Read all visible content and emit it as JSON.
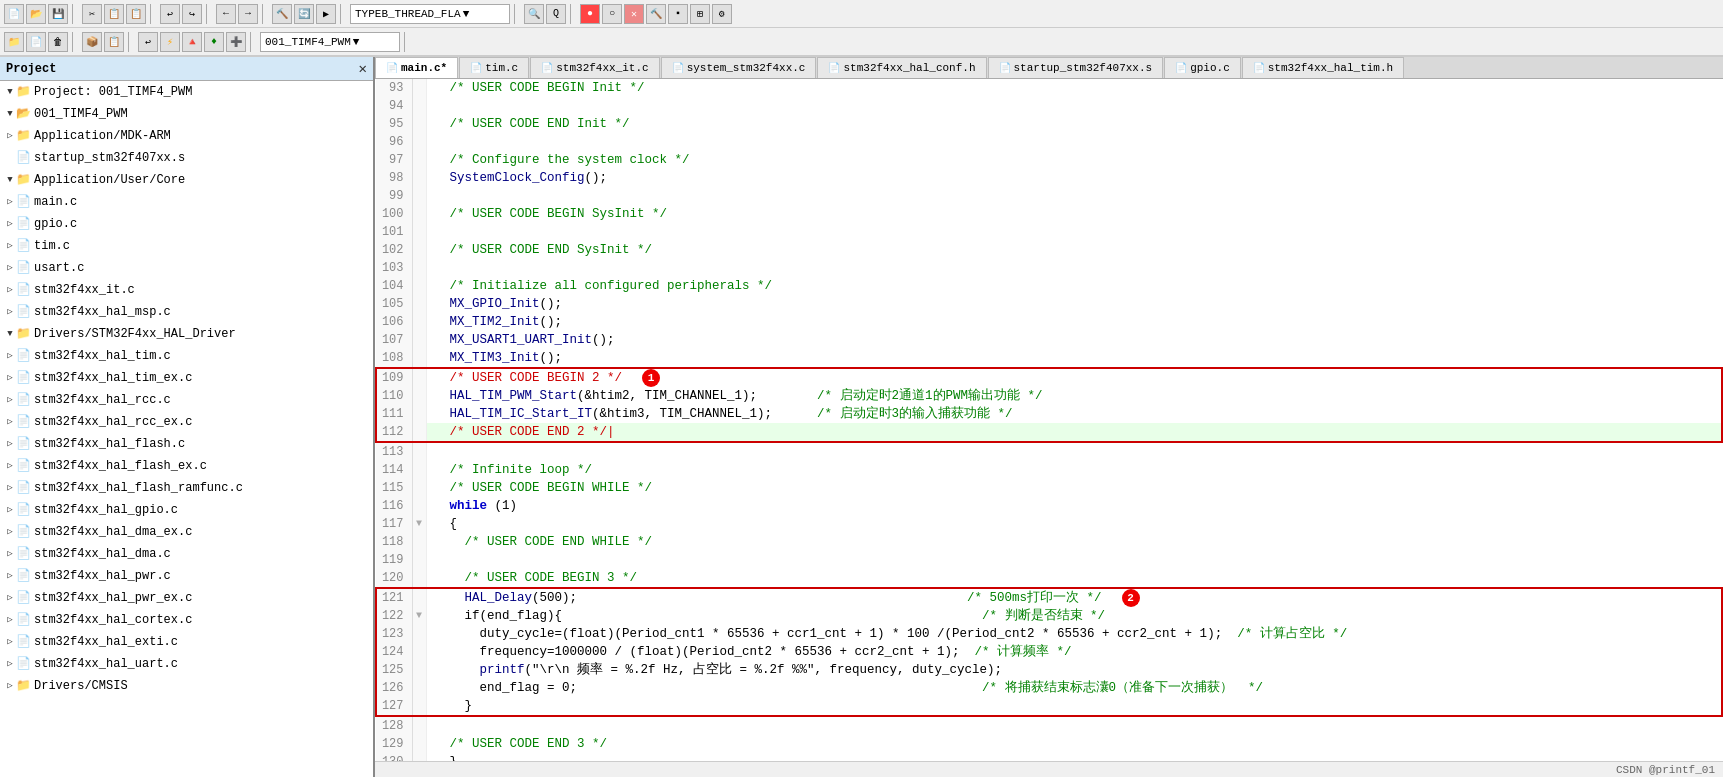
{
  "toolbar": {
    "row1_buttons": [
      "💾",
      "📄",
      "🖨",
      "✂",
      "📋",
      "📄",
      "↩",
      "↪",
      "←",
      "→",
      "⏸",
      "⏭",
      "⏮",
      "⏭",
      "⏹",
      "⏸",
      "▶",
      "⏺",
      "🔲",
      "📊",
      "🔧",
      "🔍",
      "Q",
      "🔴",
      "⭕",
      "🚫",
      "🔨",
      "▪",
      "🔲",
      "⚙"
    ],
    "row2_buttons": [
      "📁",
      "📄",
      "🗑",
      "📦",
      "📋",
      "↩",
      "⚡",
      "🔺",
      "🔸",
      "➕"
    ],
    "project_dropdown": "001_TIMF4_PWM",
    "target_dropdown": "TYPEB_THREAD_FLA"
  },
  "sidebar": {
    "title": "Project",
    "items": [
      {
        "id": "project-root",
        "label": "Project: 001_TIMF4_PWM",
        "level": 0,
        "expanded": true,
        "type": "project"
      },
      {
        "id": "001_TIMF4_PWM",
        "label": "001_TIMF4_PWM",
        "level": 1,
        "expanded": true,
        "type": "folder"
      },
      {
        "id": "app-mdk",
        "label": "Application/MDK-ARM",
        "level": 2,
        "expanded": false,
        "type": "folder"
      },
      {
        "id": "startup",
        "label": "startup_stm32f407xx.s",
        "level": 3,
        "type": "file"
      },
      {
        "id": "app-user-core",
        "label": "Application/User/Core",
        "level": 2,
        "expanded": true,
        "type": "folder"
      },
      {
        "id": "main-c",
        "label": "main.c",
        "level": 3,
        "type": "file"
      },
      {
        "id": "gpio-c",
        "label": "gpio.c",
        "level": 3,
        "type": "file"
      },
      {
        "id": "tim-c",
        "label": "tim.c",
        "level": 3,
        "type": "file"
      },
      {
        "id": "usart-c",
        "label": "usart.c",
        "level": 3,
        "type": "file"
      },
      {
        "id": "stm32f4xx-it",
        "label": "stm32f4xx_it.c",
        "level": 3,
        "type": "file"
      },
      {
        "id": "stm32f4xx-hal-msp",
        "label": "stm32f4xx_hal_msp.c",
        "level": 3,
        "type": "file"
      },
      {
        "id": "drivers-stm32",
        "label": "Drivers/STM32F4xx_HAL_Driver",
        "level": 2,
        "expanded": true,
        "type": "folder"
      },
      {
        "id": "hal-tim",
        "label": "stm32f4xx_hal_tim.c",
        "level": 3,
        "type": "file"
      },
      {
        "id": "hal-tim-ex",
        "label": "stm32f4xx_hal_tim_ex.c",
        "level": 3,
        "type": "file"
      },
      {
        "id": "hal-rcc",
        "label": "stm32f4xx_hal_rcc.c",
        "level": 3,
        "type": "file"
      },
      {
        "id": "hal-rcc-ex",
        "label": "stm32f4xx_hal_rcc_ex.c",
        "level": 3,
        "type": "file"
      },
      {
        "id": "hal-flash",
        "label": "stm32f4xx_hal_flash.c",
        "level": 3,
        "type": "file"
      },
      {
        "id": "hal-flash-ex",
        "label": "stm32f4xx_hal_flash_ex.c",
        "level": 3,
        "type": "file"
      },
      {
        "id": "hal-flash-ram",
        "label": "stm32f4xx_hal_flash_ramfunc.c",
        "level": 3,
        "type": "file"
      },
      {
        "id": "hal-gpio",
        "label": "stm32f4xx_hal_gpio.c",
        "level": 3,
        "type": "file"
      },
      {
        "id": "hal-dma-ex",
        "label": "stm32f4xx_hal_dma_ex.c",
        "level": 3,
        "type": "file"
      },
      {
        "id": "hal-dma",
        "label": "stm32f4xx_hal_dma.c",
        "level": 3,
        "type": "file"
      },
      {
        "id": "hal-pwr",
        "label": "stm32f4xx_hal_pwr.c",
        "level": 3,
        "type": "file"
      },
      {
        "id": "hal-pwr-ex",
        "label": "stm32f4xx_hal_pwr_ex.c",
        "level": 3,
        "type": "file"
      },
      {
        "id": "hal-cortex",
        "label": "stm32f4xx_hal_cortex.c",
        "level": 3,
        "type": "file"
      },
      {
        "id": "hal-exti",
        "label": "stm32f4xx_hal_exti.c",
        "level": 3,
        "type": "file"
      },
      {
        "id": "hal-uart",
        "label": "stm32f4xx_hal_uart.c",
        "level": 3,
        "type": "file"
      },
      {
        "id": "drivers-cmsis",
        "label": "Drivers/CMSIS",
        "level": 2,
        "expanded": false,
        "type": "folder"
      }
    ]
  },
  "tabs": [
    {
      "id": "main-c",
      "label": "main.c",
      "active": true,
      "modified": true
    },
    {
      "id": "tim-c",
      "label": "tim.c",
      "active": false
    },
    {
      "id": "stm32f4xx-it",
      "label": "stm32f4xx_it.c",
      "active": false
    },
    {
      "id": "system-stm32",
      "label": "system_stm32f4xx.c",
      "active": false
    },
    {
      "id": "stm32-hal-conf",
      "label": "stm32f4xx_hal_conf.h",
      "active": false
    },
    {
      "id": "startup-file",
      "label": "startup_stm32f407xx.s",
      "active": false
    },
    {
      "id": "gpio-c",
      "label": "gpio.c",
      "active": false
    },
    {
      "id": "stm32-hal-tim-h",
      "label": "stm32f4xx_hal_tim.h",
      "active": false
    }
  ],
  "code": {
    "lines": [
      {
        "num": 93,
        "fold": "",
        "text": "  /* USER CODE BEGIN Init */",
        "style": "comment"
      },
      {
        "num": 94,
        "fold": "",
        "text": "",
        "style": ""
      },
      {
        "num": 95,
        "fold": "",
        "text": "  /* USER CODE END Init */",
        "style": "comment"
      },
      {
        "num": 96,
        "fold": "",
        "text": "",
        "style": ""
      },
      {
        "num": 97,
        "fold": "",
        "text": "  /* Configure the system clock */",
        "style": "comment"
      },
      {
        "num": 98,
        "fold": "",
        "text": "  SystemClock_Config();",
        "style": ""
      },
      {
        "num": 99,
        "fold": "",
        "text": "",
        "style": ""
      },
      {
        "num": 100,
        "fold": "",
        "text": "  /* USER CODE BEGIN SysInit */",
        "style": "comment"
      },
      {
        "num": 101,
        "fold": "",
        "text": "",
        "style": ""
      },
      {
        "num": 102,
        "fold": "",
        "text": "  /* USER CODE END SysInit */",
        "style": "comment"
      },
      {
        "num": 103,
        "fold": "",
        "text": "",
        "style": ""
      },
      {
        "num": 104,
        "fold": "",
        "text": "  /* Initialize all configured peripherals */",
        "style": "comment"
      },
      {
        "num": 105,
        "fold": "",
        "text": "  MX_GPIO_Init();",
        "style": ""
      },
      {
        "num": 106,
        "fold": "",
        "text": "  MX_TIM2_Init();",
        "style": ""
      },
      {
        "num": 107,
        "fold": "",
        "text": "  MX_USART1_UART_Init();",
        "style": ""
      },
      {
        "num": 108,
        "fold": "",
        "text": "  MX_TIM3_Init();",
        "style": ""
      },
      {
        "num": 109,
        "fold": "redbox1-start",
        "text": "  /* USER CODE BEGIN 2 */",
        "style": "comment-red"
      },
      {
        "num": 110,
        "fold": "",
        "text": "  HAL_TIM_PWM_Start(&htim2, TIM_CHANNEL_1);        /* 启动定时2通道1的PWM输出功能 */",
        "style": ""
      },
      {
        "num": 111,
        "fold": "",
        "text": "  HAL_TIM_IC_Start_IT(&htim3, TIM_CHANNEL_1);      /* 启动定时3的输入捕获功能 */",
        "style": ""
      },
      {
        "num": 112,
        "fold": "redbox1-end",
        "text": "  /* USER CODE END 2 */|",
        "style": "comment-red",
        "highlight": true
      },
      {
        "num": 113,
        "fold": "",
        "text": "",
        "style": ""
      },
      {
        "num": 114,
        "fold": "",
        "text": "  /* Infinite loop */",
        "style": "comment"
      },
      {
        "num": 115,
        "fold": "",
        "text": "  /* USER CODE BEGIN WHILE */",
        "style": "comment"
      },
      {
        "num": 116,
        "fold": "",
        "text": "  while (1)",
        "style": "keyword"
      },
      {
        "num": 117,
        "fold": "▼",
        "text": "  {",
        "style": ""
      },
      {
        "num": 118,
        "fold": "",
        "text": "    /* USER CODE END WHILE */",
        "style": "comment"
      },
      {
        "num": 119,
        "fold": "",
        "text": "",
        "style": ""
      },
      {
        "num": 120,
        "fold": "",
        "text": "    /* USER CODE BEGIN 3 */",
        "style": "comment"
      },
      {
        "num": 121,
        "fold": "redbox2-start",
        "text": "    HAL_Delay(500);                                                    /* 500ms打印一次 */",
        "style": ""
      },
      {
        "num": 122,
        "fold": "▼",
        "text": "    if(end_flag){                                                        /* 判断是否结束 */",
        "style": ""
      },
      {
        "num": 123,
        "fold": "",
        "text": "      duty_cycle=(float)(Period_cnt1 * 65536 + ccr1_cnt + 1) * 100 /(Period_cnt2 * 65536 + ccr2_cnt + 1);  /* 计算占空比 */",
        "style": ""
      },
      {
        "num": 124,
        "fold": "",
        "text": "      frequency=1000000 / (float)(Period_cnt2 * 65536 + ccr2_cnt + 1);  /* 计算频率 */",
        "style": ""
      },
      {
        "num": 125,
        "fold": "",
        "text": "      printf(\"\\r\\n 频率 = %.2f Hz, 占空比 = %.2f %%\", frequency, duty_cycle);",
        "style": ""
      },
      {
        "num": 126,
        "fold": "",
        "text": "      end_flag = 0;                                                      /* 将捕获结束标志灢0（准备下一次捕获）  */",
        "style": ""
      },
      {
        "num": 127,
        "fold": "redbox2-end",
        "text": "    }",
        "style": ""
      },
      {
        "num": 128,
        "fold": "",
        "text": "",
        "style": ""
      },
      {
        "num": 129,
        "fold": "",
        "text": "  /* USER CODE END 3 */",
        "style": "comment"
      },
      {
        "num": 130,
        "fold": "",
        "text": "  }",
        "style": ""
      }
    ],
    "redbox1_lines": [
      109,
      110,
      111,
      112
    ],
    "redbox2_lines": [
      121,
      122,
      123,
      124,
      125,
      126,
      127
    ],
    "badge1_line": 109,
    "badge2_line": 121
  },
  "statusbar": {
    "text": "CSDN @printf_01"
  }
}
